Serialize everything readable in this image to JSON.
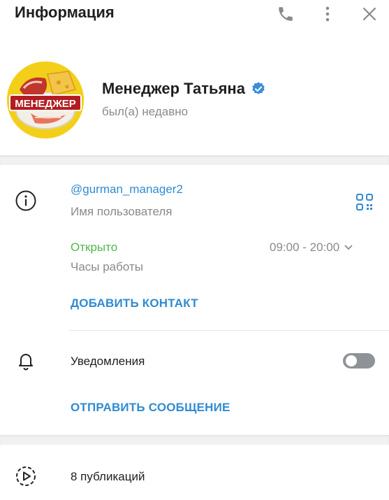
{
  "header": {
    "title": "Информация",
    "icons": [
      "phone-icon",
      "more-icon",
      "close-icon"
    ]
  },
  "profile": {
    "name": "Менеджер Татьяна",
    "status": "был(а) недавно",
    "avatar_text": "МЕНЕДЖЕР",
    "verified_icon": "verified-badge-icon"
  },
  "info": {
    "username": "@gurman_manager2",
    "username_label": "Имя пользователя",
    "hours_status": "Открыто",
    "hours_value": "09:00 - 20:00",
    "hours_label": "Часы работы",
    "add_contact": "ДОБАВИТЬ КОНТАКТ"
  },
  "notifications": {
    "label": "Уведомления",
    "enabled": false
  },
  "send_message": "ОТПРАВИТЬ СООБЩЕНИЕ",
  "publications": {
    "label": "8 публикаций"
  },
  "colors": {
    "accent": "#2f8bd2",
    "open": "#4fb84a",
    "muted": "#8a8a8a"
  }
}
